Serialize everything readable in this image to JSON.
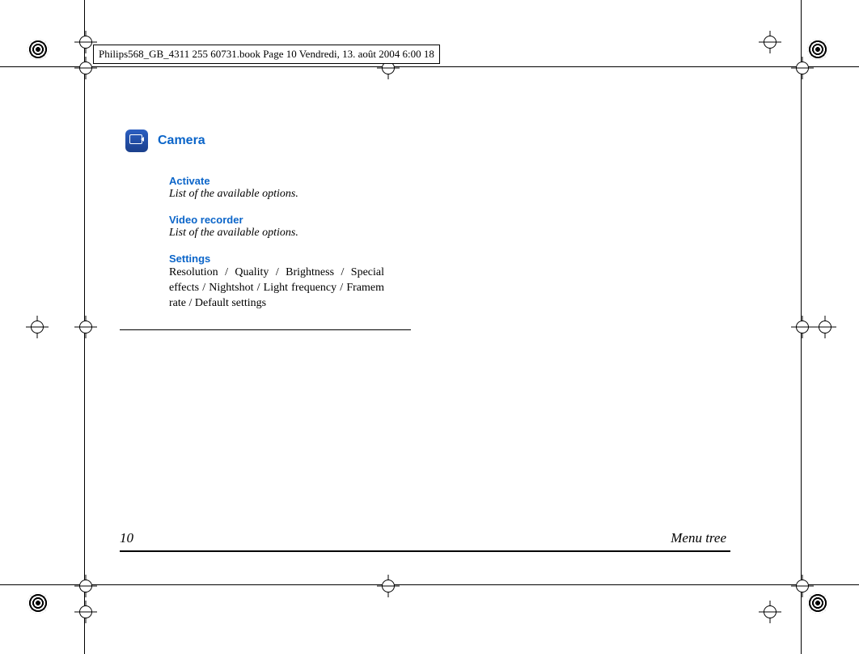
{
  "header_path": "Philips568_GB_4311 255 60731.book  Page 10  Vendredi, 13. août 2004  6:00 18",
  "section": {
    "title": "Camera",
    "blocks": [
      {
        "heading": "Activate",
        "body_italic": "List of the available options."
      },
      {
        "heading": "Video recorder",
        "body_italic": "List of the available options."
      },
      {
        "heading": "Settings",
        "body": "Resolution / Quality / Brightness / Special effects / Nightshot / Light frequency / Framem rate / Default settings"
      }
    ]
  },
  "footer": {
    "page_number": "10",
    "chapter": "Menu tree"
  }
}
